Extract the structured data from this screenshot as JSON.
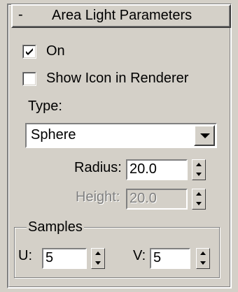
{
  "rollout": {
    "collapse_sign": "-",
    "title": "Area Light Parameters"
  },
  "on_checkbox": {
    "label": "On",
    "checked": true
  },
  "show_icon_checkbox": {
    "label": "Show Icon in Renderer",
    "checked": false
  },
  "type": {
    "label": "Type:",
    "selected": "Sphere"
  },
  "radius": {
    "label": "Radius:",
    "value": "20.0",
    "enabled": true
  },
  "height": {
    "label": "Height:",
    "value": "20.0",
    "enabled": false
  },
  "samples": {
    "label": "Samples",
    "u": {
      "label": "U:",
      "value": "5"
    },
    "v": {
      "label": "V:",
      "value": "5"
    }
  },
  "icons": {
    "checkmark": "checkmark-icon",
    "dropdown": "chevron-down-icon",
    "spinner_up": "spinner-up-icon",
    "spinner_down": "spinner-down-icon"
  },
  "colors": {
    "panel": "#d4d0c8",
    "field": "#ffffff",
    "disabled_text": "#808080"
  }
}
